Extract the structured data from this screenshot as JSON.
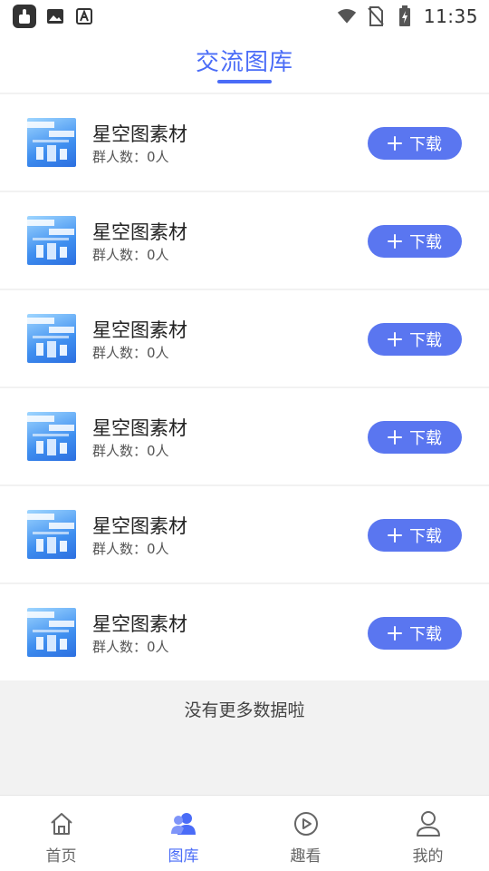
{
  "status_bar": {
    "time": "11:35",
    "left_icons": [
      "app-notification-icon",
      "image-icon",
      "accessibility-icon"
    ],
    "right_icons": [
      "wifi-icon",
      "no-sim-icon",
      "battery-charging-icon"
    ]
  },
  "header": {
    "title": "交流图库"
  },
  "items": [
    {
      "name": "星空图素材",
      "count_text": "群人数：0人",
      "button_label": "下载"
    },
    {
      "name": "星空图素材",
      "count_text": "群人数：0人",
      "button_label": "下载"
    },
    {
      "name": "星空图素材",
      "count_text": "群人数：0人",
      "button_label": "下载"
    },
    {
      "name": "星空图素材",
      "count_text": "群人数：0人",
      "button_label": "下载"
    },
    {
      "name": "星空图素材",
      "count_text": "群人数：0人",
      "button_label": "下载"
    },
    {
      "name": "星空图素材",
      "count_text": "群人数：0人",
      "button_label": "下载"
    }
  ],
  "footer_text": "没有更多数据啦",
  "tabbar": {
    "tabs": [
      {
        "label": "首页",
        "icon": "home-icon",
        "active": false
      },
      {
        "label": "图库",
        "icon": "gallery-users-icon",
        "active": true
      },
      {
        "label": "趣看",
        "icon": "play-icon",
        "active": false
      },
      {
        "label": "我的",
        "icon": "profile-icon",
        "active": false
      }
    ]
  },
  "colors": {
    "accent": "#4a6cf7",
    "button": "#5a76f0",
    "background": "#f2f2f2"
  }
}
